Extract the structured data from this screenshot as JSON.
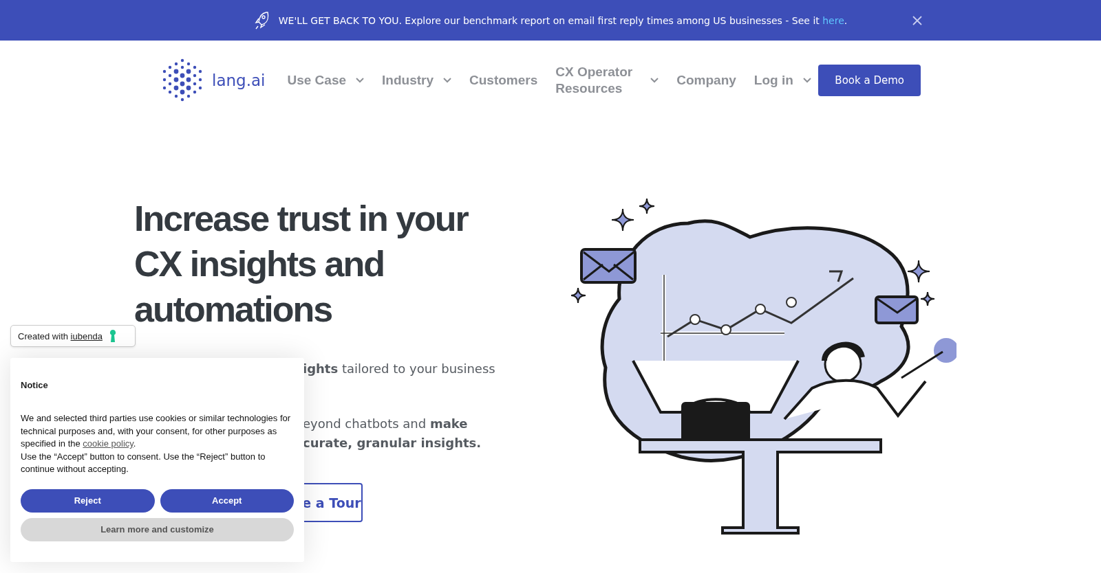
{
  "announcement": {
    "text": "WE'LL GET BACK TO YOU. Explore our benchmark report on email first reply times among US businesses - See it ",
    "link": "here",
    "suffix": "."
  },
  "logo": {
    "text": "lang.ai"
  },
  "nav": [
    {
      "label": "Use Case",
      "has_menu": true
    },
    {
      "label": "Industry",
      "has_menu": true
    },
    {
      "label": "Customers",
      "has_menu": false
    },
    {
      "label": "CX Operator Resources",
      "has_menu": true
    },
    {
      "label": "Company",
      "has_menu": false
    },
    {
      "label": "Log in",
      "has_menu": true
    }
  ],
  "cta": {
    "label": "Book a Demo"
  },
  "hero": {
    "headline": "Increase trust in your CX insights and automations",
    "paragraphs": [
      [
        "**ights** tailored to your business"
      ],
      [
        "eyond chatbots and **make**",
        "**curate, granular insights.**"
      ]
    ],
    "tour_button": "e a Tour"
  },
  "iubenda_badge": {
    "text": "Created with ",
    "link": "iubenda"
  },
  "cookie_notice": {
    "title": "Notice",
    "body": "We and selected third parties use cookies or similar technologies for technical purposes and, with your consent, for other purposes as specified in the ",
    "link": "cookie policy",
    "body_end": ".",
    "body2": "Use the “Accept” button to consent. Use the “Reject” button to continue without accepting.",
    "buttons": [
      {
        "label": "Reject",
        "kind": "primary"
      },
      {
        "label": "Accept",
        "kind": "primary"
      },
      {
        "label": "Learn more and customize",
        "kind": "secondary"
      }
    ]
  }
}
